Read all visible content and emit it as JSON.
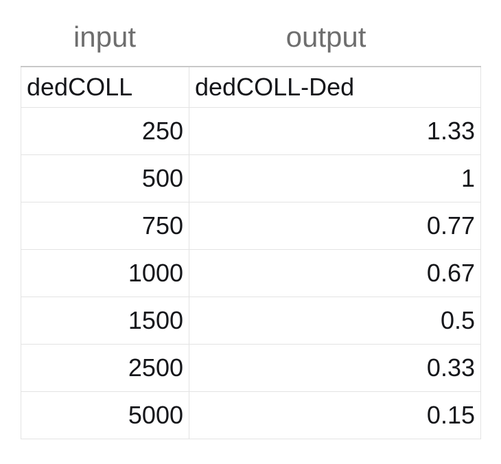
{
  "captions": {
    "input_label": "input",
    "output_label": "output"
  },
  "table": {
    "headers": {
      "input_column": "dedCOLL",
      "output_column": "dedCOLL-Ded"
    },
    "rows": [
      {
        "input": "250",
        "output": "1.33"
      },
      {
        "input": "500",
        "output": "1"
      },
      {
        "input": "750",
        "output": "0.77"
      },
      {
        "input": "1000",
        "output": "0.67"
      },
      {
        "input": "1500",
        "output": "0.5"
      },
      {
        "input": "2500",
        "output": "0.33"
      },
      {
        "input": "5000",
        "output": "0.15"
      }
    ]
  },
  "colors": {
    "header_cell_background": "#c9e9c6",
    "header_cell_text": "#1f6b1c",
    "caption_text": "#6e6e6e",
    "cell_text": "#15161a",
    "grid_line": "#e3e3e3"
  },
  "chart_data": {
    "type": "table",
    "title": "",
    "categories": [
      "250",
      "500",
      "750",
      "1000",
      "1500",
      "2500",
      "5000"
    ],
    "columns": [
      "dedCOLL",
      "dedCOLL-Ded"
    ],
    "series": [
      {
        "name": "dedCOLL-Ded",
        "values": [
          1.33,
          1,
          0.77,
          0.67,
          0.5,
          0.33,
          0.15
        ]
      }
    ],
    "xlabel": "dedCOLL",
    "ylabel": "dedCOLL-Ded"
  }
}
